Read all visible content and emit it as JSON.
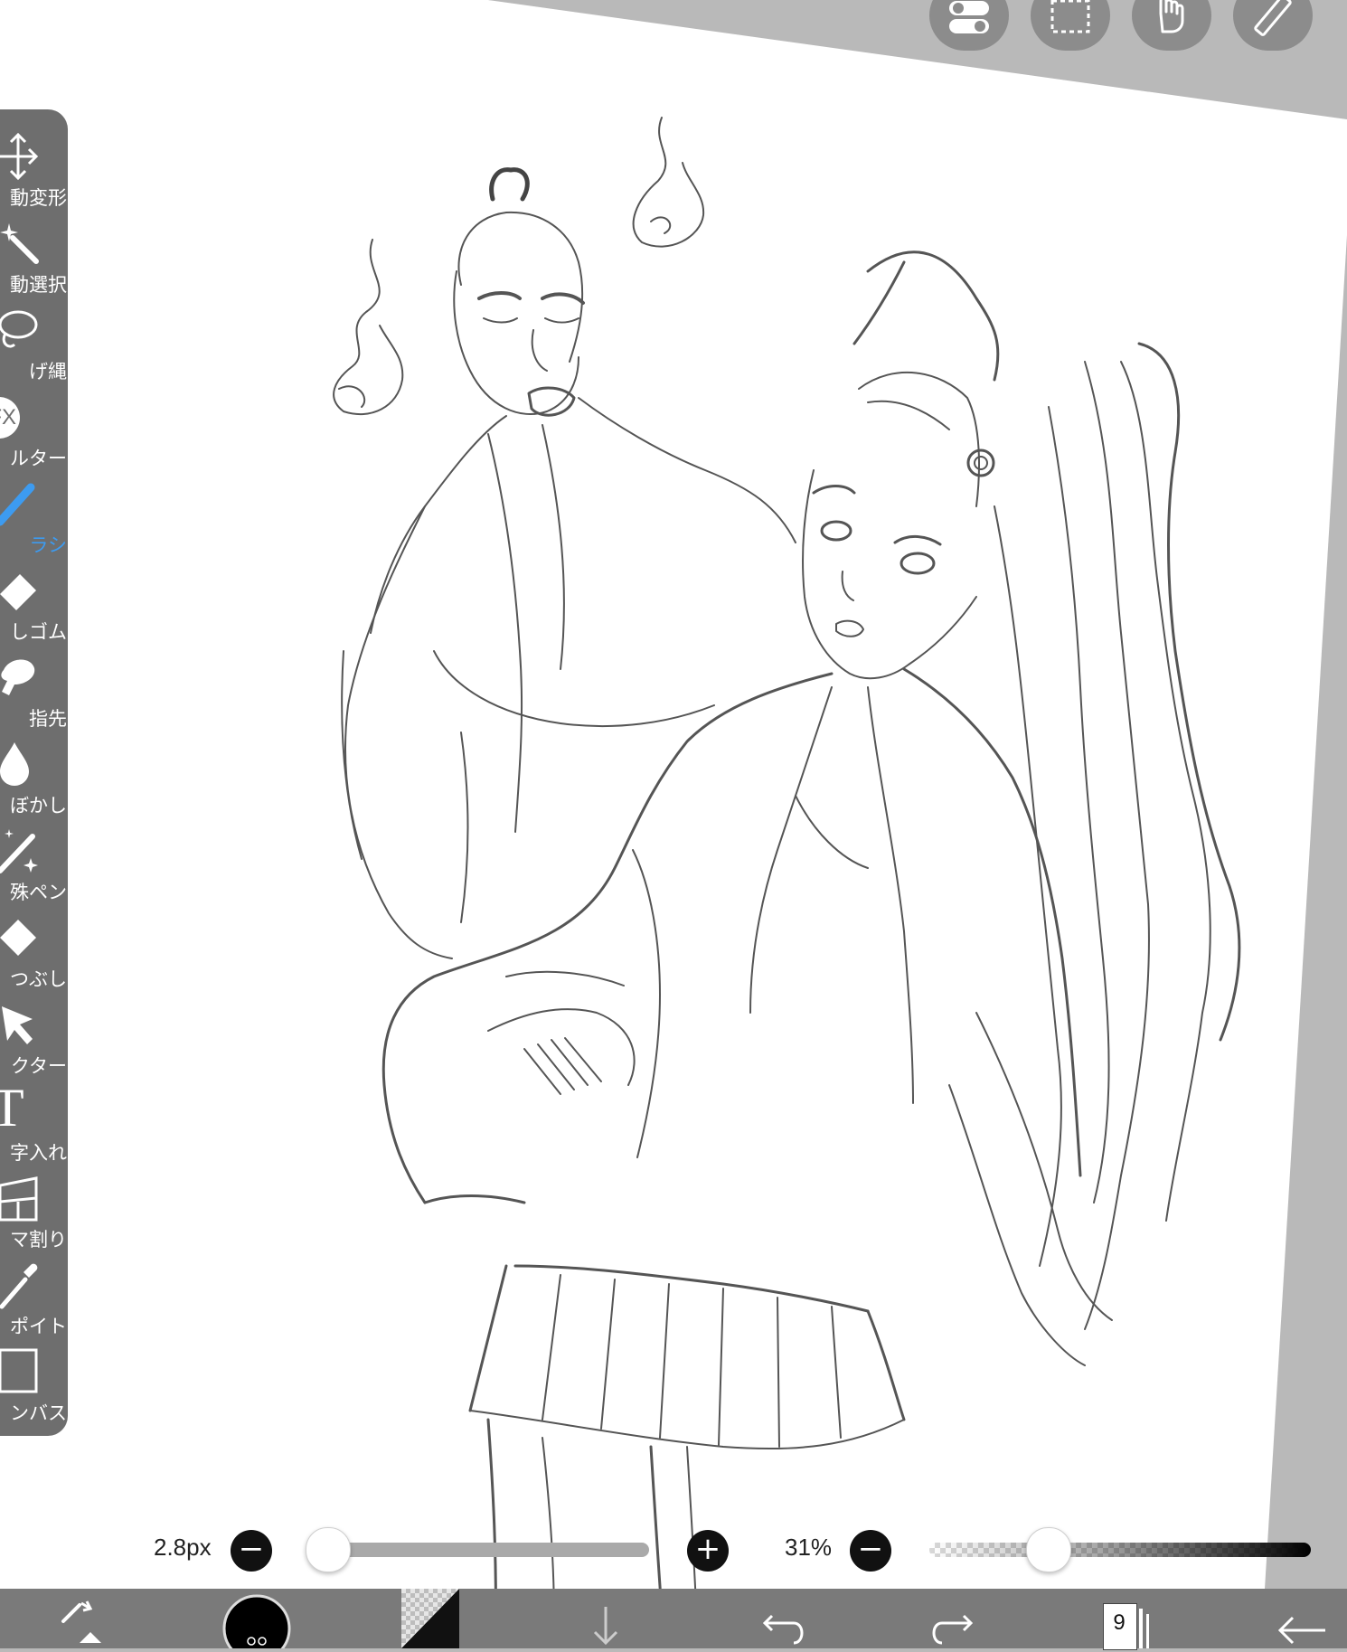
{
  "toolbar": {
    "tools": [
      {
        "label": "動変形",
        "icon": "move-transform-icon"
      },
      {
        "label": "動選択",
        "icon": "magic-wand-icon"
      },
      {
        "label": "げ縄",
        "icon": "lasso-icon"
      },
      {
        "label": "ルター",
        "icon": "fx-filter-icon"
      },
      {
        "label": "ラシ",
        "icon": "brush-icon",
        "active": true
      },
      {
        "label": "しゴム",
        "icon": "eraser-icon"
      },
      {
        "label": "指先",
        "icon": "smudge-finger-icon"
      },
      {
        "label": "ぼかし",
        "icon": "blur-drop-icon"
      },
      {
        "label": "殊ペン",
        "icon": "special-pen-icon"
      },
      {
        "label": "つぶし",
        "icon": "fill-bucket-icon"
      },
      {
        "label": "クター",
        "icon": "selector-arrow-icon"
      },
      {
        "label": "字入れ",
        "icon": "text-icon"
      },
      {
        "label": "マ割り",
        "icon": "frame-divider-icon"
      },
      {
        "label": "ポイト",
        "icon": "eyedropper-icon"
      },
      {
        "label": "ンバス",
        "icon": "canvas-icon"
      }
    ],
    "active_color": "#3d9bf0"
  },
  "fx_text": "FX",
  "text_tool_glyph": "T",
  "top_buttons": [
    "toggle-icon",
    "selection-rect-icon",
    "hand-icon",
    "ruler-icon"
  ],
  "brush_size": {
    "value_label": "2.8px",
    "minus": "−",
    "plus": "+",
    "level": 0.0
  },
  "opacity": {
    "value_label": "31%",
    "minus": "−",
    "level": 0.31
  },
  "bottom_bar": {
    "layer_count": "9",
    "items": [
      "brush-swap-icon",
      "color-swatch",
      "fill-pattern-swatch",
      "download-arrow-icon",
      "undo-icon",
      "redo-icon",
      "layers-icon",
      "back-arrow-icon"
    ]
  }
}
